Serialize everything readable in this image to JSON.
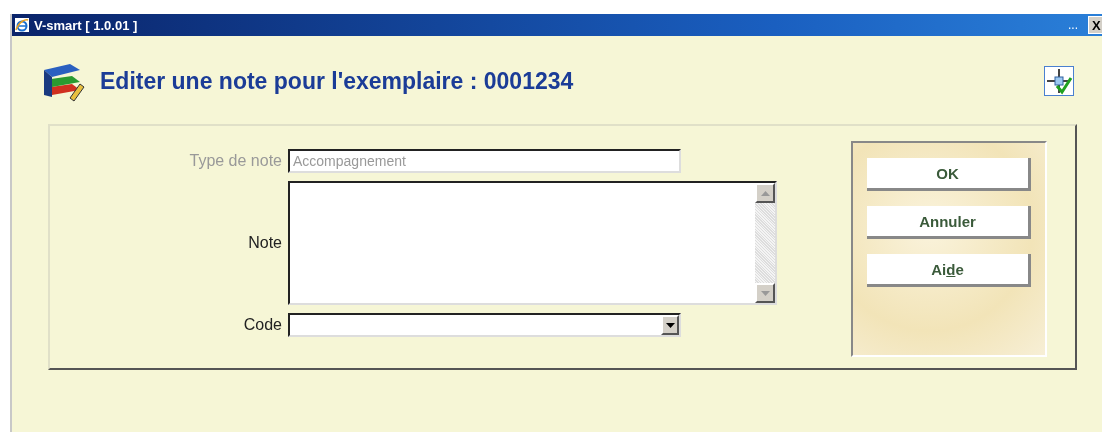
{
  "window": {
    "title": "V-smart [ 1.0.01 ]",
    "ellipsis": "...",
    "close": "X"
  },
  "heading": "Editer une note pour l'exemplaire : 0001234",
  "form": {
    "fields": [
      {
        "kind": "text",
        "label": "Type de note",
        "value": "Accompagnement",
        "disabled": true
      },
      {
        "kind": "textarea",
        "label": "Note",
        "disabled": false
      },
      {
        "kind": "select",
        "label": "Code",
        "disabled": false
      }
    ]
  },
  "buttons": [
    {
      "parts": [
        {
          "text": "OK",
          "underline": false
        }
      ]
    },
    {
      "parts": [
        {
          "text": "Annuler",
          "underline": false
        }
      ]
    },
    {
      "parts": [
        {
          "text": "Ai",
          "underline": false
        },
        {
          "text": "d",
          "underline": true
        },
        {
          "text": "e",
          "underline": false
        }
      ]
    }
  ]
}
